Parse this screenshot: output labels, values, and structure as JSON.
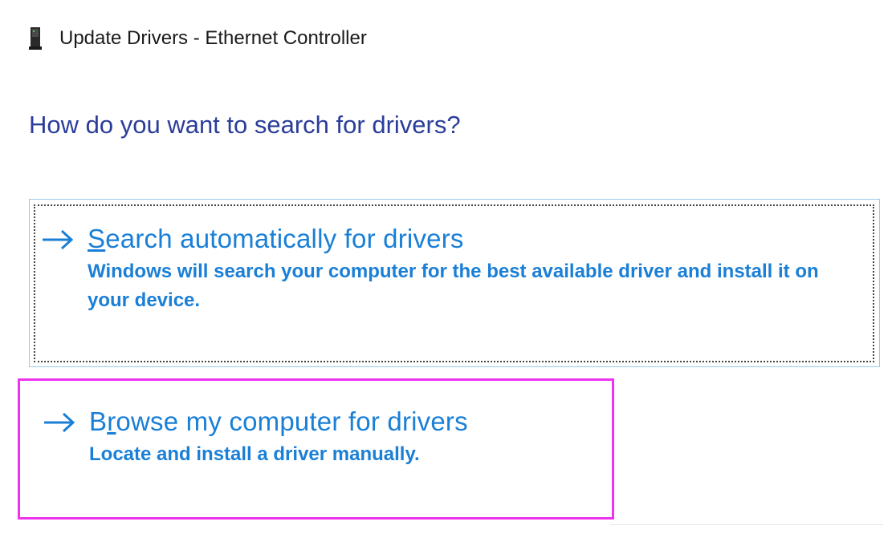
{
  "window": {
    "title": "Update Drivers - Ethernet Controller",
    "icon": "network-adapter-icon"
  },
  "heading": "How do you want to search for drivers?",
  "options": [
    {
      "title_pre": "",
      "title_access": "S",
      "title_post": "earch automatically for drivers",
      "description": "Windows will search your computer for the best available driver and install it on your device.",
      "icon": "arrow-right-icon"
    },
    {
      "title_pre": "B",
      "title_access": "r",
      "title_post": "owse my computer for drivers",
      "description": "Locate and install a driver manually.",
      "icon": "arrow-right-icon"
    }
  ],
  "colors": {
    "link_blue": "#1a7fd6",
    "heading_blue": "#2b3d9a",
    "highlight_magenta": "#ee33ee",
    "option_border": "#99c9ea"
  }
}
